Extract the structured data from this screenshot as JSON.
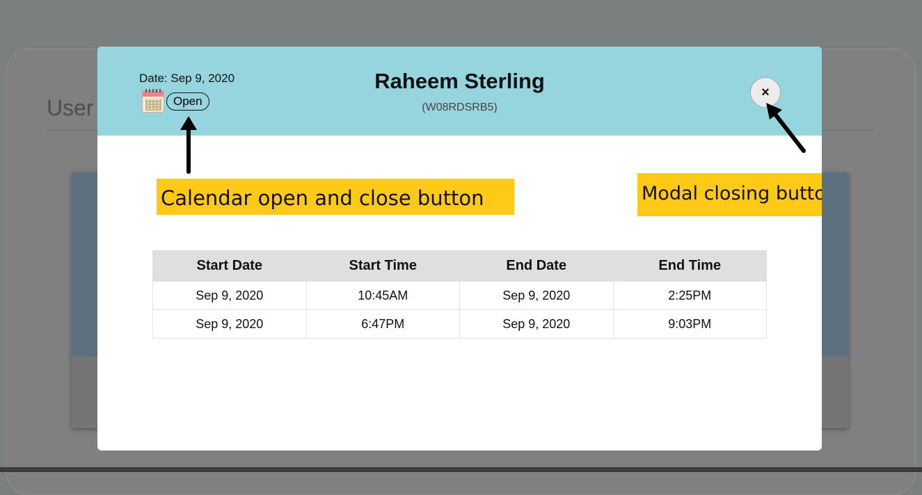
{
  "background": {
    "title": "User"
  },
  "modal": {
    "date_label": "Date: Sep 9, 2020",
    "calendar_button": "Open",
    "name": "Raheem Sterling",
    "user_id": "(W08RDSRB5)",
    "close_label": "×",
    "annotations": {
      "calendar_callout": "Calendar open and close button",
      "close_callout": "Modal closing button"
    },
    "table": {
      "headers": [
        "Start Date",
        "Start Time",
        "End Date",
        "End Time"
      ],
      "rows": [
        [
          "Sep 9, 2020",
          "10:45AM",
          "Sep 9, 2020",
          "2:25PM"
        ],
        [
          "Sep 9, 2020",
          "6:47PM",
          "Sep 9, 2020",
          "9:03PM"
        ]
      ]
    }
  },
  "colors": {
    "header_bg": "#96d5de",
    "callout_bg": "#ffc918",
    "overlay_bg": "#7b7f7f"
  },
  "icons": [
    "calendar-icon",
    "close-icon",
    "arrow-icon"
  ]
}
